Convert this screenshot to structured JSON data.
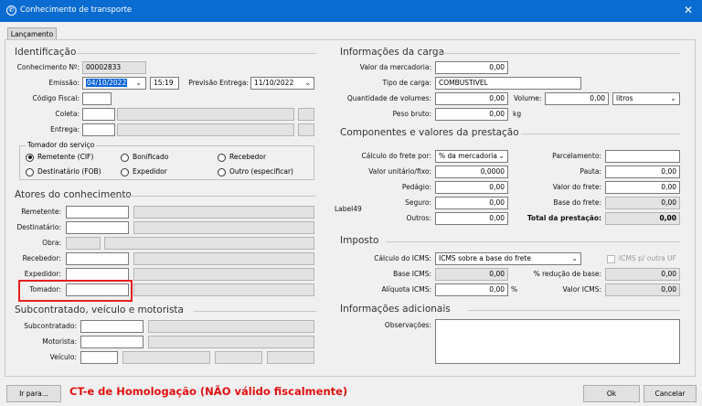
{
  "window": {
    "title": "Conhecimento de transporte",
    "close_glyph": "✕",
    "icon_glyph": "✆"
  },
  "tab": {
    "label": "Lançamento"
  },
  "identificacao": {
    "section": "Identificação",
    "conhecimento_label": "Conhecimento Nº:",
    "conhecimento_value": "00002833",
    "emissao_label": "Emissão:",
    "emissao_date": "04/10/2022",
    "emissao_time": "15:19",
    "previsao_label": "Previsão Entrega:",
    "previsao_date": "11/10/2022",
    "codigo_fiscal_label": "Código Fiscal:",
    "coleta_label": "Coleta:",
    "entrega_label": "Entrega:",
    "tomador_group": "Tomador do serviço",
    "options": [
      "Remetente (CIF)",
      "Bonificado",
      "Recebedor",
      "Destinatário (FOB)",
      "Expedidor",
      "Outro (especificar)"
    ],
    "selected": "Remetente (CIF)"
  },
  "atores": {
    "section": "Atores do conhecimento",
    "remetente": "Remetente:",
    "destinatario": "Destinatário:",
    "obra": "Obra:",
    "recebedor": "Recebedor:",
    "expedidor": "Expedidor:",
    "tomador": "Tomador:"
  },
  "subcontratado": {
    "section": "Subcontratado, veículo e motorista",
    "subcontratado": "Subcontratado:",
    "motorista": "Motorista:",
    "veiculo": "Veículo:"
  },
  "carga": {
    "section": "Informações da carga",
    "valor_label": "Valor da mercadoria:",
    "valor": "0,00",
    "tipo_label": "Tipo de carga:",
    "tipo": "COMBUSTIVEL",
    "quantidade_label": "Quantidade de volumes:",
    "quantidade": "0,00",
    "volume_label": "Volume:",
    "volume": "0,00",
    "volume_unit": "litros",
    "peso_label": "Peso bruto:",
    "peso": "0,00",
    "peso_unit": "kg"
  },
  "componentes": {
    "section": "Componentes e valores da prestação",
    "calculo_label": "Cálculo do frete por:",
    "calculo": "% da mercadoria",
    "valor_unitario_label": "Valor unitário/fixo:",
    "valor_unitario": "0,0000",
    "pedagio_label": "Pedágio:",
    "pedagio": "0,00",
    "seguro_label": "Seguro:",
    "seguro": "0,00",
    "outros_label": "Outros:",
    "outros": "0,00",
    "label49": "Label49",
    "parcelamento_label": "Parcelamento:",
    "pauta_label": "Pauta:",
    "pauta": "0,00",
    "valor_frete_label": "Valor do frete:",
    "valor_frete": "0,00",
    "base_frete_label": "Base do frete:",
    "base_frete": "0,00",
    "total_label": "Total da prestação:",
    "total": "0,00"
  },
  "imposto": {
    "section": "Imposto",
    "calculo_label": "Cálculo do ICMS:",
    "calculo": "ICMS sobre a base do frete",
    "icms_outra_uf": "ICMS p/ outra UF",
    "base_label": "Base ICMS:",
    "base": "0,00",
    "reducao_label": "% redução de base:",
    "reducao": "0,00",
    "aliquota_label": "Alíquota ICMS:",
    "aliquota": "0,00",
    "aliquota_unit": "%",
    "valor_label": "Valor ICMS:",
    "valor": "0,00"
  },
  "adicionais": {
    "section": "Informações adicionais",
    "observacoes_label": "Observações:"
  },
  "footer": {
    "ir_para": "Ir para...",
    "warning": "CT-e de Homologação (NÃO válido fiscalmente)",
    "ok": "Ok",
    "cancelar": "Cancelar"
  },
  "colors": {
    "titlebar": "#0a6bd1",
    "warning": "#e01010",
    "highlight": "#e52020"
  }
}
